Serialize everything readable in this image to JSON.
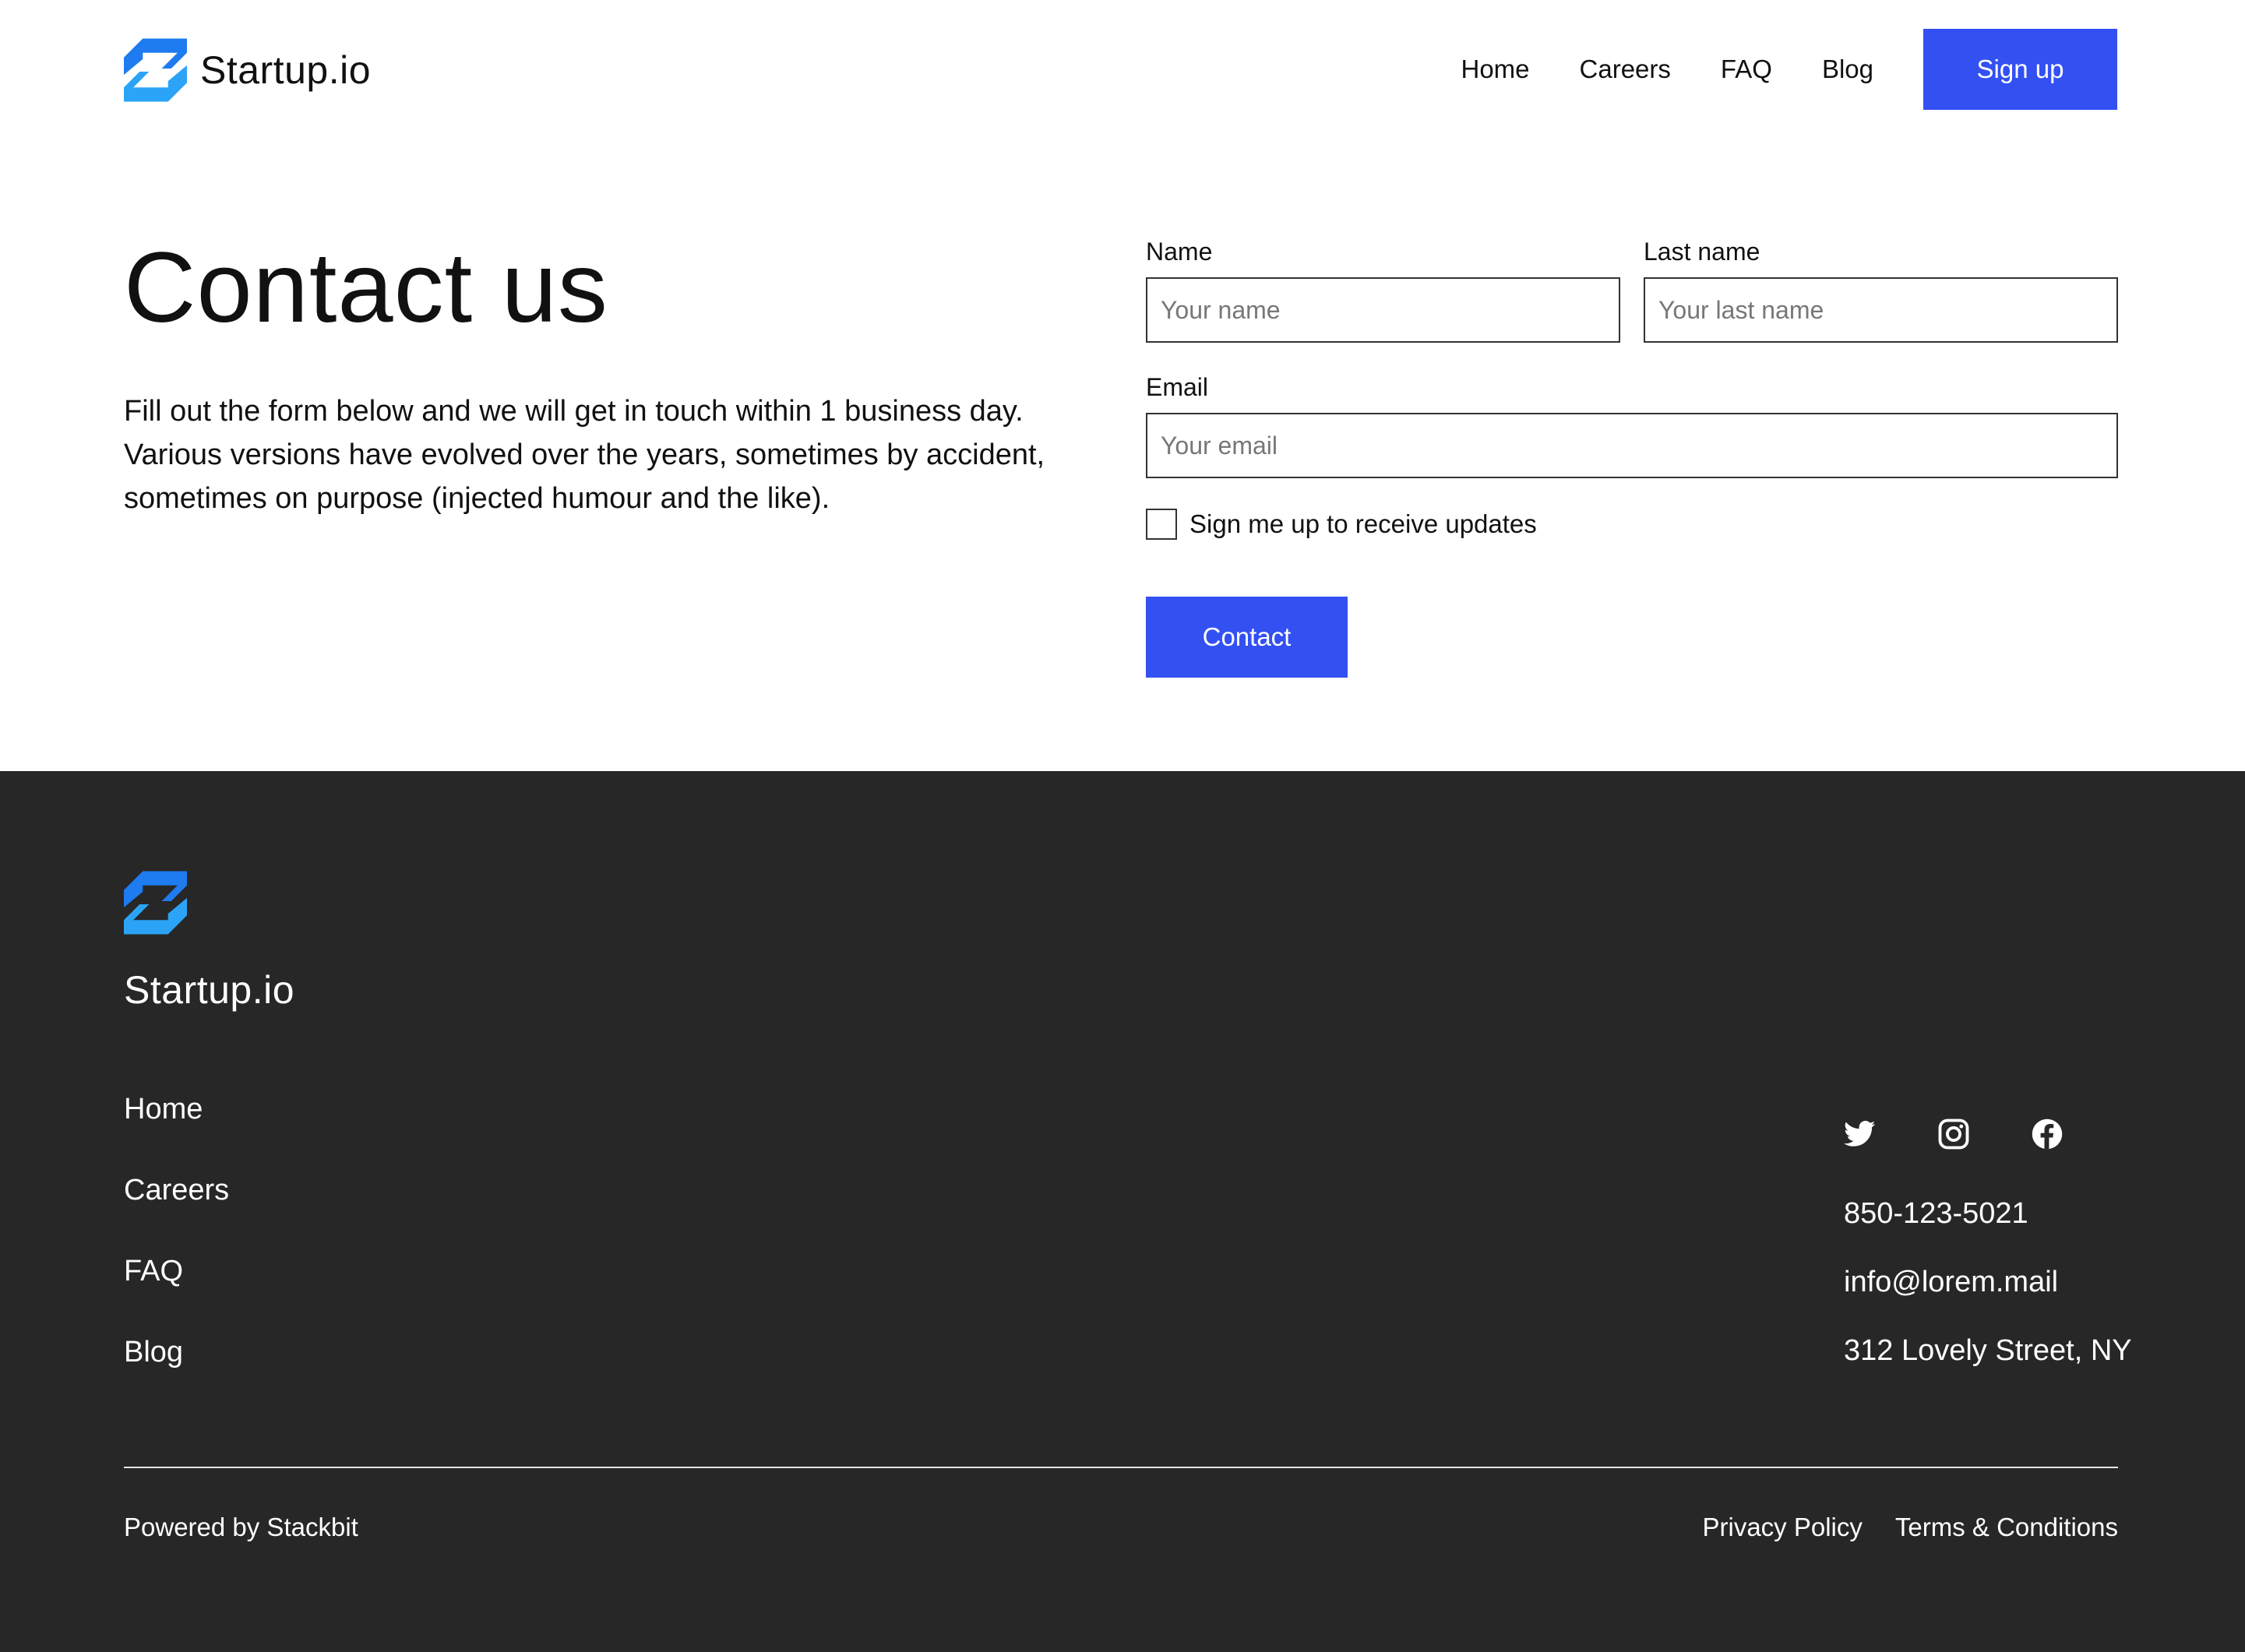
{
  "brand": {
    "name": "Startup.io",
    "icon": "startup-logo-icon",
    "accent_color": "#2196f3"
  },
  "header": {
    "nav": [
      {
        "label": "Home"
      },
      {
        "label": "Careers"
      },
      {
        "label": "FAQ"
      },
      {
        "label": "Blog"
      }
    ],
    "signup_label": "Sign up",
    "button_color": "#3350f2"
  },
  "intro": {
    "title": "Contact us",
    "description": "Fill out the form below and we will get in touch within 1 business day. Various versions have evolved over the years, sometimes by accident, sometimes on purpose (injected humour and the like)."
  },
  "form": {
    "name": {
      "label": "Name",
      "placeholder": "Your name",
      "value": ""
    },
    "last_name": {
      "label": "Last name",
      "placeholder": "Your last name",
      "value": ""
    },
    "email": {
      "label": "Email",
      "placeholder": "Your email",
      "value": ""
    },
    "updates_checkbox": {
      "label": "Sign me up to receive updates",
      "checked": false
    },
    "submit_label": "Contact"
  },
  "footer": {
    "background_color": "#272727",
    "brand_name": "Startup.io",
    "nav": [
      {
        "label": "Home"
      },
      {
        "label": "Careers"
      },
      {
        "label": "FAQ"
      },
      {
        "label": "Blog"
      }
    ],
    "social": [
      "twitter-icon",
      "instagram-icon",
      "facebook-icon"
    ],
    "phone": "850-123-5021",
    "email": "info@lorem.mail",
    "address": "312 Lovely Street, NY",
    "powered_by": "Powered by Stackbit",
    "legal": [
      {
        "label": "Privacy Policy"
      },
      {
        "label": "Terms & Conditions"
      }
    ]
  }
}
